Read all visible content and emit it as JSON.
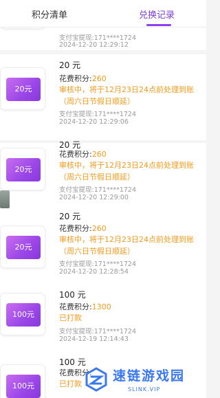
{
  "tabs": {
    "points_list": "积分清单",
    "exchange_records": "兑换记录",
    "active": "exchange_records"
  },
  "records": [
    {
      "detail": "支付宝提现:171****1724",
      "time": "2024-12-20 12:29:12"
    },
    {
      "coupon": "20元",
      "title": "20 元",
      "points_label": "花费积分:",
      "points": "260",
      "status": "审核中，将于12月23日24点前处理到账（周六日节假日顺延）",
      "detail": "支付宝提现:171****1724",
      "time": "2024-12-20 12:29:06"
    },
    {
      "coupon": "20元",
      "title": "20 元",
      "points_label": "花费积分:",
      "points": "260",
      "status": "审核中，将于12月23日24点前处理到账（周六日节假日顺延）",
      "detail": "支付宝提现:171****1724",
      "time": "2024-12-20 12:29:00"
    },
    {
      "coupon": "20元",
      "title": "20 元",
      "points_label": "花费积分:",
      "points": "260",
      "status": "审核中，将于12月23日24点前处理到账（周六日节假日顺延）",
      "detail": "支付宝提现:171****1724",
      "time": "2024-12-20 12:28:54"
    },
    {
      "coupon": "100元",
      "title": "100 元",
      "points_label": "花费积分:",
      "points": "1300",
      "status": "已打款",
      "detail": "支付宝提现:171****1724",
      "time": "2024-12-19 12:14:43"
    },
    {
      "coupon": "100元",
      "title": "100 元",
      "points_label": "花费积分:",
      "status": "已打款"
    }
  ],
  "watermark": {
    "name": "速链游戏园",
    "site": "SLINK.VIP"
  },
  "colors": {
    "accent": "#8b3ff0",
    "orange": "#f39a1c",
    "watermark": "#3a78f2"
  }
}
